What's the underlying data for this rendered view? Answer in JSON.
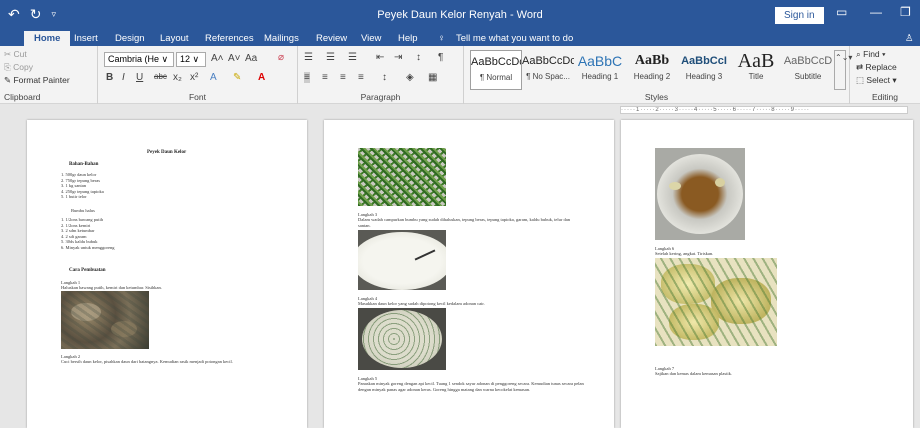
{
  "window": {
    "title": "Peyek Daun Kelor Renyah  -  Word",
    "sign_in": "Sign in"
  },
  "tabs": [
    "Home",
    "Insert",
    "Design",
    "Layout",
    "References",
    "Mailings",
    "Review",
    "View",
    "Help"
  ],
  "tell_me": "Tell me what you want to do",
  "clipboard": {
    "cut": "Cut",
    "copy": "Copy",
    "format_painter": "Format Painter",
    "label": "Clipboard"
  },
  "font": {
    "name": "Cambria (He",
    "size": "12",
    "label": "Font"
  },
  "paragraph": {
    "label": "Paragraph"
  },
  "styles": {
    "label": "Styles",
    "items": [
      {
        "preview": "AaBbCcDc",
        "name": "¶ Normal"
      },
      {
        "preview": "AaBbCcDc",
        "name": "¶ No Spac..."
      },
      {
        "preview": "AaBbC",
        "name": "Heading 1"
      },
      {
        "preview": "AaBb",
        "name": "Heading 2"
      },
      {
        "preview": "AaBbCcI",
        "name": "Heading 3"
      },
      {
        "preview": "AaB",
        "name": "Title"
      },
      {
        "preview": "AaBbCcD",
        "name": "Subtitle"
      }
    ]
  },
  "editing": {
    "find": "Find",
    "replace": "Replace",
    "select": "Select",
    "label": "Editing"
  },
  "page1": {
    "title": "Peyek Daun Kelor",
    "bahan": "Bahan-Bahan",
    "list1": [
      "1.  500gr daun kelor",
      "2.  750gr tepung beras",
      "3.  1 kg santan",
      "4.  250gr tepung tapioka",
      "5.  1 butir telor"
    ],
    "bumbu": "Bumbu halus",
    "list2": [
      "1.  1/2ons bawang putih",
      "2.  1/2ons kemiri",
      "3.  2 sdm ketumbar",
      "4.  2 sdt garam",
      "5.  30ds kaldu bubuk",
      "6.  Minyak untuk menggoreng"
    ],
    "cara": "Cara Pembuatan",
    "step1": "Langkah 1",
    "step1_text": "Haluskan bawang putih, kemiri dan ketumbar. Sisihkan.",
    "step2": "Langkah 2",
    "step2_text": "Cuci bersih daun kelor, pisahkan daun dari batangnya. Kemudian rasik menjadi potongan kecil."
  },
  "page2": {
    "step3": "Langkah 3",
    "step3_text": "Dalam wadah campurkan bumbu yang sudah dihaluskan, tepung beras, tepung tapioka, garam, kaldu bubuk, telur dan santan.",
    "step4": "Langkah 4",
    "step4_text": "Masukkan daun kelor yang sudah dipotong kecil kedalam adonan cair.",
    "step5": "Langkah 5",
    "step5_text": "Panaskan minyak goreng dengan api kecil. Tuang 1 sendok sayur adonan di penggoreng secara. Kemudian tunas secara pelan dengan minyak panas agar adonan keras. Goreng hingga matang dan warna kecokelat kemasan."
  },
  "page3": {
    "step6": "Langkah 6",
    "step6_text": "Setelah kering, angkat. Tiriskan.",
    "step7": "Langkah 7",
    "step7_text": "Sajikan dan kemas dalam kemasan plastik."
  }
}
